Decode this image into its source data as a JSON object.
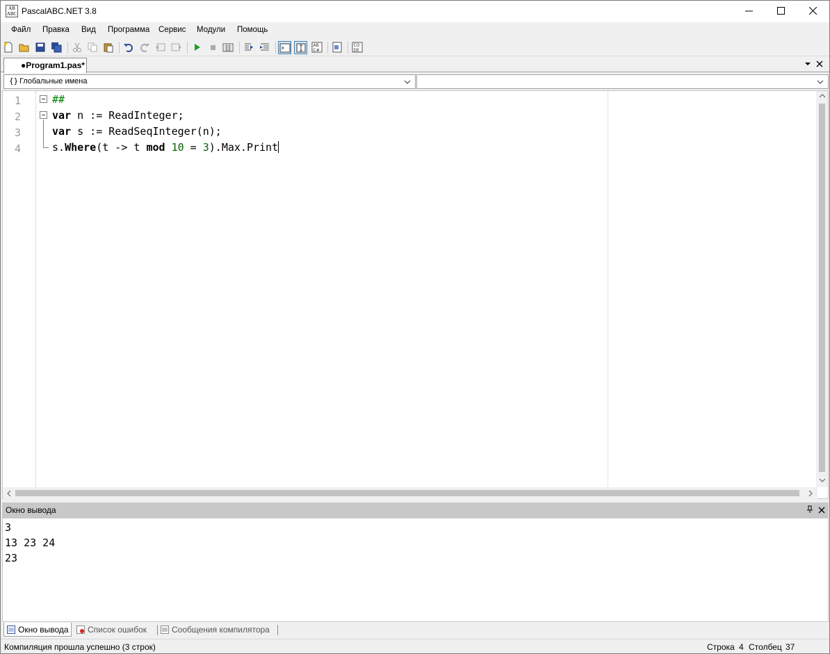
{
  "window": {
    "title": "PascalABC.NET 3.8",
    "icon_text": "AB\nABC"
  },
  "menu": {
    "items": [
      "Файл",
      "Правка",
      "Вид",
      "Программа",
      "Сервис",
      "Модули",
      "Помощь"
    ]
  },
  "tab": {
    "label": "●Program1.pas*",
    "dropdown_icon": "chevron-down-icon",
    "close_icon": "close-icon"
  },
  "combos": {
    "left": "Глобальные имена",
    "left_icon": "{}",
    "right": ""
  },
  "editor": {
    "line_numbers": [
      "1",
      "2",
      "3",
      "4"
    ],
    "lines": [
      {
        "segments": [
          {
            "t": "##",
            "c": "cmt"
          }
        ]
      },
      {
        "segments": [
          {
            "t": "var",
            "c": "kw"
          },
          {
            "t": " n := ReadInteger;",
            "c": ""
          }
        ]
      },
      {
        "segments": [
          {
            "t": "var",
            "c": "kw"
          },
          {
            "t": " s := ReadSeqInteger(n);",
            "c": ""
          }
        ]
      },
      {
        "segments": [
          {
            "t": "s.",
            "c": ""
          },
          {
            "t": "Where",
            "c": "kw"
          },
          {
            "t": "(t -> t ",
            "c": ""
          },
          {
            "t": "mod",
            "c": "kw"
          },
          {
            "t": " ",
            "c": ""
          },
          {
            "t": "10",
            "c": "num"
          },
          {
            "t": " = ",
            "c": ""
          },
          {
            "t": "3",
            "c": "num"
          },
          {
            "t": ").Max.Print",
            "c": ""
          }
        ]
      }
    ]
  },
  "output": {
    "title": "Окно вывода",
    "lines": [
      "3",
      "13 23 24",
      "23"
    ]
  },
  "bottom_tabs": [
    "Окно вывода",
    "Список ошибок",
    "Сообщения компилятора"
  ],
  "status": {
    "message": "Компиляция прошла успешно (3 строк)",
    "row_label": "Строка",
    "row_value": "4",
    "col_label": "Столбец",
    "col_value": "37"
  },
  "colors": {
    "accent": "#3c7fb1",
    "keyword": "#000000",
    "number": "#006400",
    "comment": "#008000",
    "output_header": "#c8c8c8"
  }
}
